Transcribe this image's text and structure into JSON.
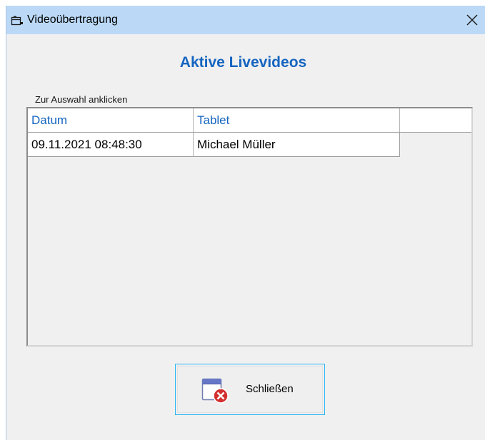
{
  "window": {
    "title": "Videoübertragung",
    "title_icon": "window-icon",
    "close_icon": "close-icon"
  },
  "main": {
    "heading": "Aktive Livevideos",
    "hint": "Zur Auswahl anklicken"
  },
  "table": {
    "columns": [
      "Datum",
      "Tablet"
    ],
    "rows": [
      {
        "datum": "09.11.2021 08:48:30",
        "tablet": "Michael Müller"
      }
    ]
  },
  "buttons": {
    "close_label": "Schließen",
    "close_icon": "window-close-icon"
  },
  "colors": {
    "titlebar": "#bbd9f7",
    "accent": "#1565c0",
    "button_border": "#29b6f6",
    "close_badge": "#d32f2f"
  }
}
